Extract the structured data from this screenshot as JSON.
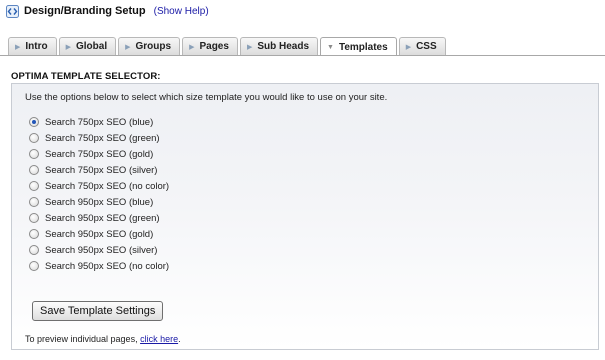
{
  "header": {
    "icon": "code-brackets-icon",
    "title": "Design/Branding Setup",
    "help_link": "(Show Help)"
  },
  "tabs": [
    {
      "label": "Intro",
      "active": false
    },
    {
      "label": "Global",
      "active": false
    },
    {
      "label": "Groups",
      "active": false
    },
    {
      "label": "Pages",
      "active": false
    },
    {
      "label": "Sub Heads",
      "active": false
    },
    {
      "label": "Templates",
      "active": true
    },
    {
      "label": "CSS",
      "active": false
    }
  ],
  "section": {
    "title": "OPTIMA TEMPLATE SELECTOR:",
    "intro": "Use the options below to select which size template you would like to use on your site."
  },
  "template_options": [
    {
      "label": "Search 750px SEO (blue)",
      "checked": true
    },
    {
      "label": "Search 750px SEO (green)",
      "checked": false
    },
    {
      "label": "Search 750px SEO (gold)",
      "checked": false
    },
    {
      "label": "Search 750px SEO (silver)",
      "checked": false
    },
    {
      "label": "Search 750px SEO (no color)",
      "checked": false
    },
    {
      "label": "Search 950px SEO (blue)",
      "checked": false
    },
    {
      "label": "Search 950px SEO (green)",
      "checked": false
    },
    {
      "label": "Search 950px SEO (gold)",
      "checked": false
    },
    {
      "label": "Search 950px SEO (silver)",
      "checked": false
    },
    {
      "label": "Search 950px SEO (no color)",
      "checked": false
    }
  ],
  "save_button": "Save Template Settings",
  "preview": {
    "text": "To preview individual pages, ",
    "link": "click here",
    "suffix": "."
  },
  "colors": {
    "link": "#1a1aa6",
    "radio_selected": "#2256b8",
    "panel_border": "#c8ccd3"
  }
}
